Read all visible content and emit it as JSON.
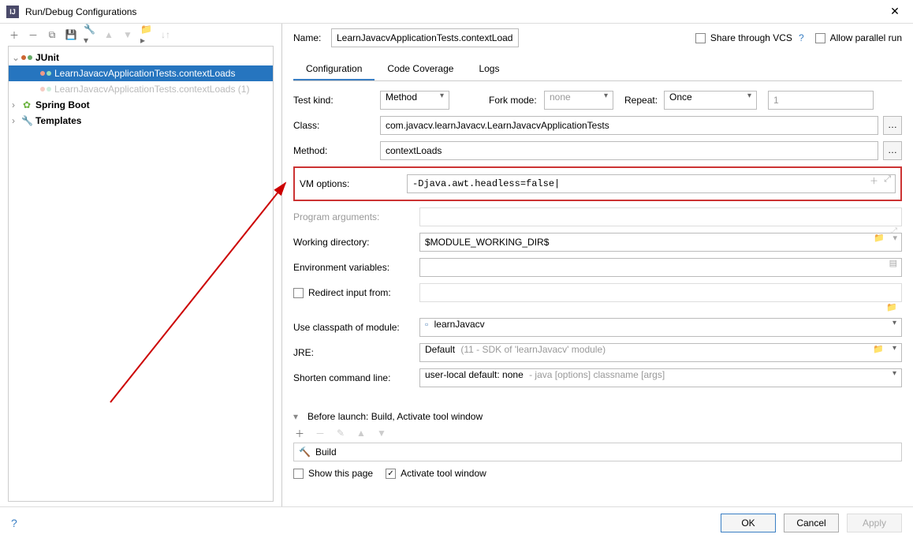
{
  "window": {
    "title": "Run/Debug Configurations"
  },
  "tree": {
    "root_junit": "JUnit",
    "selected": "LearnJavacvApplicationTests.contextLoads",
    "dimmed": "LearnJavacvApplicationTests.contextLoads (1)",
    "spring": "Spring Boot",
    "templates": "Templates"
  },
  "header": {
    "name_label": "Name:",
    "name_value": "LearnJavacvApplicationTests.contextLoads",
    "share": "Share through VCS",
    "parallel": "Allow parallel run"
  },
  "tabs": {
    "config": "Configuration",
    "coverage": "Code Coverage",
    "logs": "Logs"
  },
  "form": {
    "test_kind_label": "Test kind:",
    "test_kind_value": "Method",
    "fork_label": "Fork mode:",
    "fork_value": "none",
    "repeat_label": "Repeat:",
    "repeat_value": "Once",
    "repeat_count": "1",
    "class_label": "Class:",
    "class_value": "com.javacv.learnJavacv.LearnJavacvApplicationTests",
    "method_label": "Method:",
    "method_value": "contextLoads",
    "vm_label": "VM options:",
    "vm_value": "-Djava.awt.headless=false|",
    "progargs_label": "Program arguments:",
    "workdir_label": "Working directory:",
    "workdir_value": "$MODULE_WORKING_DIR$",
    "env_label": "Environment variables:",
    "redirect_label": "Redirect input from:",
    "classpath_label": "Use classpath of module:",
    "classpath_value": "learnJavacv",
    "jre_label": "JRE:",
    "jre_value": "Default",
    "jre_hint": "(11 - SDK of 'learnJavacv' module)",
    "shorten_label": "Shorten command line:",
    "shorten_value": "user-local default: none",
    "shorten_hint": "- java [options] classname [args]"
  },
  "before": {
    "title": "Before launch: Build, Activate tool window",
    "build": "Build",
    "show_page": "Show this page",
    "activate": "Activate tool window"
  },
  "footer": {
    "ok": "OK",
    "cancel": "Cancel",
    "apply": "Apply"
  }
}
